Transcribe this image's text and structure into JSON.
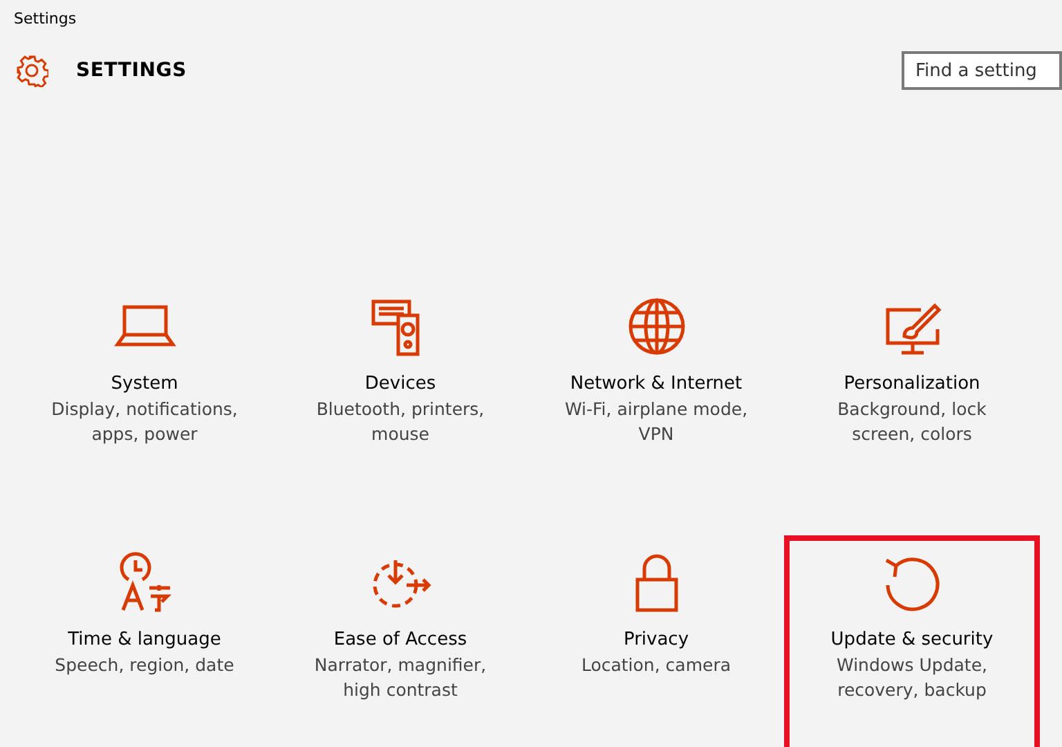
{
  "window": {
    "title": "Settings"
  },
  "header": {
    "title": "SETTINGS",
    "search": {
      "placeholder": "Find a setting"
    }
  },
  "categories": [
    {
      "kind": "system",
      "title": "System",
      "description": "Display, notifications, apps, power",
      "highlighted": false
    },
    {
      "kind": "devices",
      "title": "Devices",
      "description": "Bluetooth, printers, mouse",
      "highlighted": false
    },
    {
      "kind": "network",
      "title": "Network & Internet",
      "description": "Wi-Fi, airplane mode, VPN",
      "highlighted": false
    },
    {
      "kind": "personalization",
      "title": "Personalization",
      "description": "Background, lock screen, colors",
      "highlighted": false
    },
    {
      "kind": "time",
      "title": "Time & language",
      "description": "Speech, region, date",
      "highlighted": false
    },
    {
      "kind": "ease",
      "title": "Ease of Access",
      "description": "Narrator, magnifier, high contrast",
      "highlighted": false
    },
    {
      "kind": "privacy",
      "title": "Privacy",
      "description": "Location, camera",
      "highlighted": false
    },
    {
      "kind": "update",
      "title": "Update & security",
      "description": "Windows Update, recovery, backup",
      "highlighted": true
    }
  ]
}
